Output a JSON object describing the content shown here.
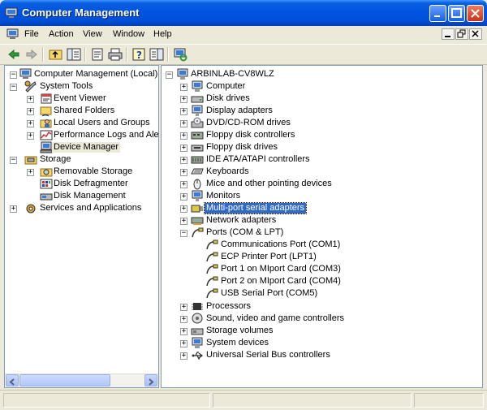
{
  "window": {
    "title": "Computer Management",
    "controls": [
      "minimize",
      "maximize",
      "close"
    ]
  },
  "menubar": {
    "items": [
      "File",
      "Action",
      "View",
      "Window",
      "Help"
    ]
  },
  "toolbar": {
    "icons": [
      "back-icon",
      "forward-icon",
      "up-folder-icon",
      "show-tree-icon",
      "properties-icon",
      "print-icon",
      "help-icon",
      "show-pane-icon",
      "scan-hardware-icon"
    ]
  },
  "left_tree": {
    "items": [
      {
        "label": "Computer Management (Local)",
        "icon": "computer-management-icon",
        "expander": "minus"
      },
      {
        "label": "System Tools",
        "icon": "system-tools-icon",
        "expander": "minus"
      },
      {
        "label": "Event Viewer",
        "icon": "event-viewer-icon",
        "expander": "plus"
      },
      {
        "label": "Shared Folders",
        "icon": "shared-folders-icon",
        "expander": "plus"
      },
      {
        "label": "Local Users and Groups",
        "icon": "users-icon",
        "expander": "plus"
      },
      {
        "label": "Performance Logs and Alerts",
        "icon": "performance-icon",
        "expander": "plus"
      },
      {
        "label": "Device Manager",
        "icon": "device-manager-icon",
        "expander": "none"
      },
      {
        "label": "Storage",
        "icon": "storage-icon",
        "expander": "minus"
      },
      {
        "label": "Removable Storage",
        "icon": "removable-storage-icon",
        "expander": "plus"
      },
      {
        "label": "Disk Defragmenter",
        "icon": "defragmenter-icon",
        "expander": "none"
      },
      {
        "label": "Disk Management",
        "icon": "disk-management-icon",
        "expander": "none"
      },
      {
        "label": "Services and Applications",
        "icon": "services-icon",
        "expander": "plus"
      }
    ]
  },
  "right_tree": {
    "items": [
      {
        "label": "ARBINLAB-CV8WLZ",
        "icon": "computer-icon",
        "expander": "minus"
      },
      {
        "label": "Computer",
        "icon": "computer-icon",
        "expander": "plus"
      },
      {
        "label": "Disk drives",
        "icon": "disk-drive-icon",
        "expander": "plus"
      },
      {
        "label": "Display adapters",
        "icon": "display-icon",
        "expander": "plus"
      },
      {
        "label": "DVD/CD-ROM drives",
        "icon": "cdrom-icon",
        "expander": "plus"
      },
      {
        "label": "Floppy disk controllers",
        "icon": "floppy-controller-icon",
        "expander": "plus"
      },
      {
        "label": "Floppy disk drives",
        "icon": "floppy-drive-icon",
        "expander": "plus"
      },
      {
        "label": "IDE ATA/ATAPI controllers",
        "icon": "ide-icon",
        "expander": "plus"
      },
      {
        "label": "Keyboards",
        "icon": "keyboard-icon",
        "expander": "plus"
      },
      {
        "label": "Mice and other pointing devices",
        "icon": "mouse-icon",
        "expander": "plus"
      },
      {
        "label": "Monitors",
        "icon": "monitor-icon",
        "expander": "plus"
      },
      {
        "label": "Multi-port serial adapters",
        "icon": "serial-adapter-icon",
        "expander": "plus"
      },
      {
        "label": "Network adapters",
        "icon": "network-icon",
        "expander": "plus"
      },
      {
        "label": "Ports (COM & LPT)",
        "icon": "port-icon",
        "expander": "minus"
      },
      {
        "label": "Communications Port (COM1)",
        "icon": "port-icon",
        "expander": "none"
      },
      {
        "label": "ECP Printer Port (LPT1)",
        "icon": "port-icon",
        "expander": "none"
      },
      {
        "label": "Port 1 on MIport Card (COM3)",
        "icon": "port-icon",
        "expander": "none"
      },
      {
        "label": "Port 2 on MIport Card (COM4)",
        "icon": "port-icon",
        "expander": "none"
      },
      {
        "label": "USB Serial Port (COM5)",
        "icon": "port-icon",
        "expander": "none"
      },
      {
        "label": "Processors",
        "icon": "processor-icon",
        "expander": "plus"
      },
      {
        "label": "Sound, video and game controllers",
        "icon": "sound-icon",
        "expander": "plus"
      },
      {
        "label": "Storage volumes",
        "icon": "storage-volume-icon",
        "expander": "plus"
      },
      {
        "label": "System devices",
        "icon": "system-device-icon",
        "expander": "plus"
      },
      {
        "label": "Universal Serial Bus controllers",
        "icon": "usb-icon",
        "expander": "plus"
      }
    ]
  },
  "colors": {
    "titlebar": "#0053e1",
    "selection": "#316ac5",
    "chrome": "#ece9d8",
    "pane_border": "#7f9db9"
  }
}
